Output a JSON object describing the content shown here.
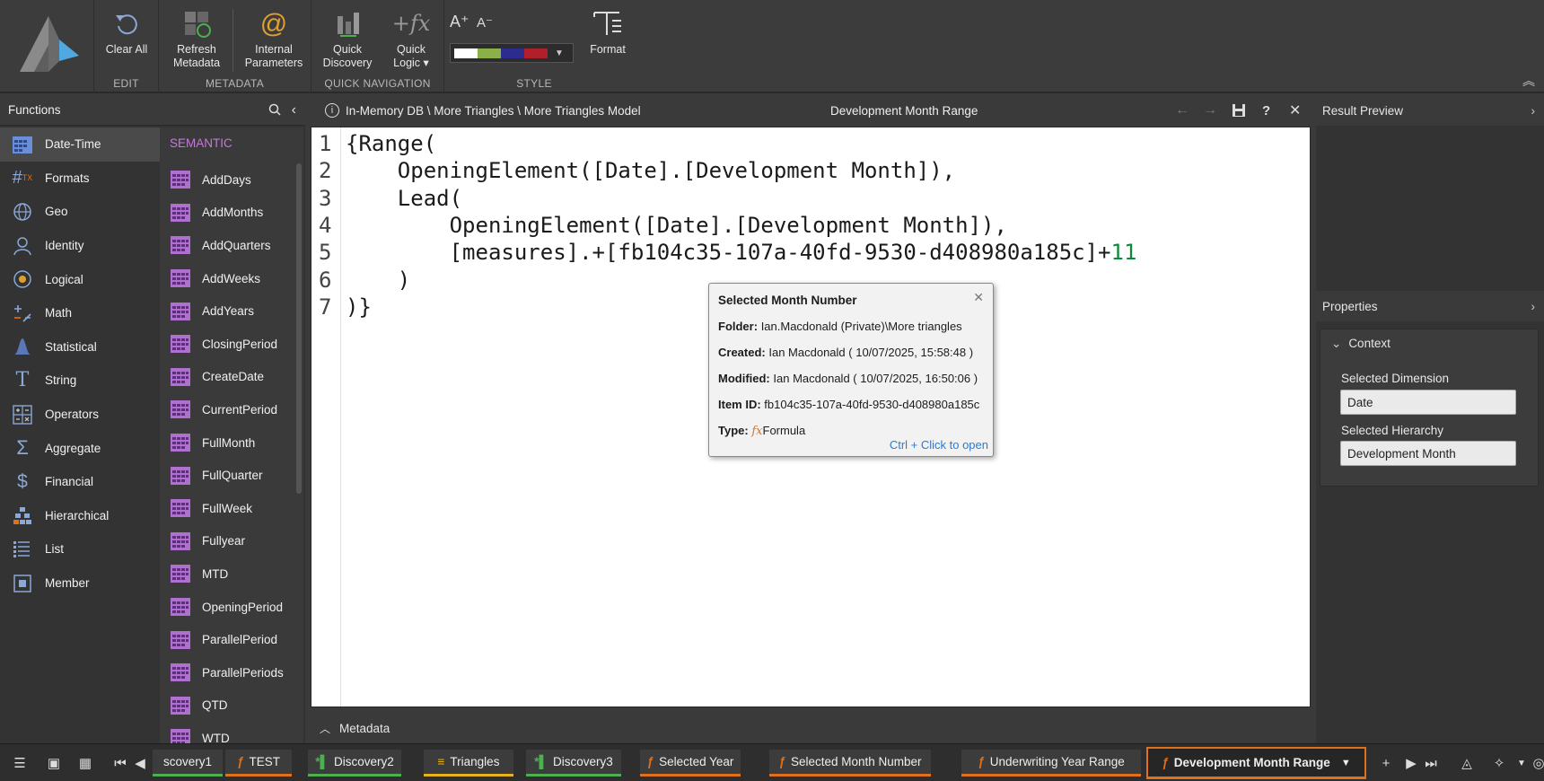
{
  "ribbon": {
    "edit": {
      "title": "EDIT",
      "clear_all": "Clear All"
    },
    "metadata": {
      "title": "METADATA",
      "refresh": "Refresh\nMetadata",
      "internal": "Internal\nParameters"
    },
    "quick_nav": {
      "title": "QUICK NAVIGATION",
      "discovery": "Quick\nDiscovery",
      "logic": "Quick\nLogic ▾"
    },
    "style": {
      "title": "STYLE",
      "format": "Format",
      "font_increase": "A⁺",
      "font_decrease": "A⁻",
      "palette": [
        "#ffffff",
        "#8bb04a",
        "#2c2c8e",
        "#b0202a"
      ]
    }
  },
  "functions": {
    "title": "Functions",
    "categories": [
      "Date-Time",
      "Formats",
      "Geo",
      "Identity",
      "Logical",
      "Math",
      "Statistical",
      "String",
      "Operators",
      "Aggregate",
      "Financial",
      "Hierarchical",
      "List",
      "Member"
    ],
    "semantic_header": "SEMANTIC",
    "items": [
      "AddDays",
      "AddMonths",
      "AddQuarters",
      "AddWeeks",
      "AddYears",
      "ClosingPeriod",
      "CreateDate",
      "CurrentPeriod",
      "FullMonth",
      "FullQuarter",
      "FullWeek",
      "Fullyear",
      "MTD",
      "OpeningPeriod",
      "ParallelPeriod",
      "ParallelPeriods",
      "QTD",
      "WTD"
    ]
  },
  "editor": {
    "breadcrumb": "In-Memory DB \\ More Triangles \\ More Triangles Model",
    "title": "Development Month Range",
    "lines": [
      {
        "n": "1",
        "text": "{Range("
      },
      {
        "n": "2",
        "text": "    OpeningElement([Date].[Development Month]),"
      },
      {
        "n": "3",
        "text": "    Lead("
      },
      {
        "n": "4",
        "text": "        OpeningElement([Date].[Development Month]),"
      },
      {
        "n": "5",
        "text": "        [measures].+[fb104c35-107a-40fd-9530-d408980a185c]+",
        "num": "11"
      },
      {
        "n": "6",
        "text": "    )"
      },
      {
        "n": "7",
        "text": ")}"
      }
    ],
    "metadata_label": "Metadata"
  },
  "tooltip": {
    "title": "Selected Month Number",
    "folder_label": "Folder:",
    "folder": "Ian.Macdonald (Private)\\More triangles",
    "created_label": "Created:",
    "created": "Ian Macdonald ( 10/07/2025, 15:58:48 )",
    "modified_label": "Modified:",
    "modified": "Ian Macdonald ( 10/07/2025, 16:50:06 )",
    "itemid_label": "Item ID:",
    "itemid": "fb104c35-107a-40fd-9530-d408980a185c",
    "type_label": "Type:",
    "type_icon": "fx",
    "type": "Formula",
    "hint": "Ctrl + Click to open"
  },
  "right": {
    "result_preview": "Result Preview",
    "properties": "Properties",
    "context": "Context",
    "dim_label": "Selected Dimension",
    "dim_value": "Date",
    "hier_label": "Selected Hierarchy",
    "hier_value": "Development Month"
  },
  "tabs": [
    {
      "label": "scovery1",
      "icon": "",
      "color": "#4caf50"
    },
    {
      "label": "TEST",
      "icon": "fx",
      "color": "#e0701c"
    },
    {
      "label": "Discovery2",
      "icon": "*",
      "color": "#4caf50"
    },
    {
      "label": "Triangles",
      "icon": "db",
      "color": "#e8b317"
    },
    {
      "label": "Discovery3",
      "icon": "*",
      "color": "#4caf50"
    },
    {
      "label": "Selected Year",
      "icon": "fx",
      "color": "#e0701c"
    },
    {
      "label": "Selected Month Number",
      "icon": "fx",
      "color": "#e0701c"
    },
    {
      "label": "Underwriting Year Range",
      "icon": "fx",
      "color": "#e0701c"
    },
    {
      "label": "Development Month Range",
      "icon": "fx",
      "color": "#e0701c",
      "active": true
    }
  ],
  "colors": {
    "accent": "#e0701c",
    "semantic": "#c678dd",
    "link": "#2a7bd4"
  }
}
